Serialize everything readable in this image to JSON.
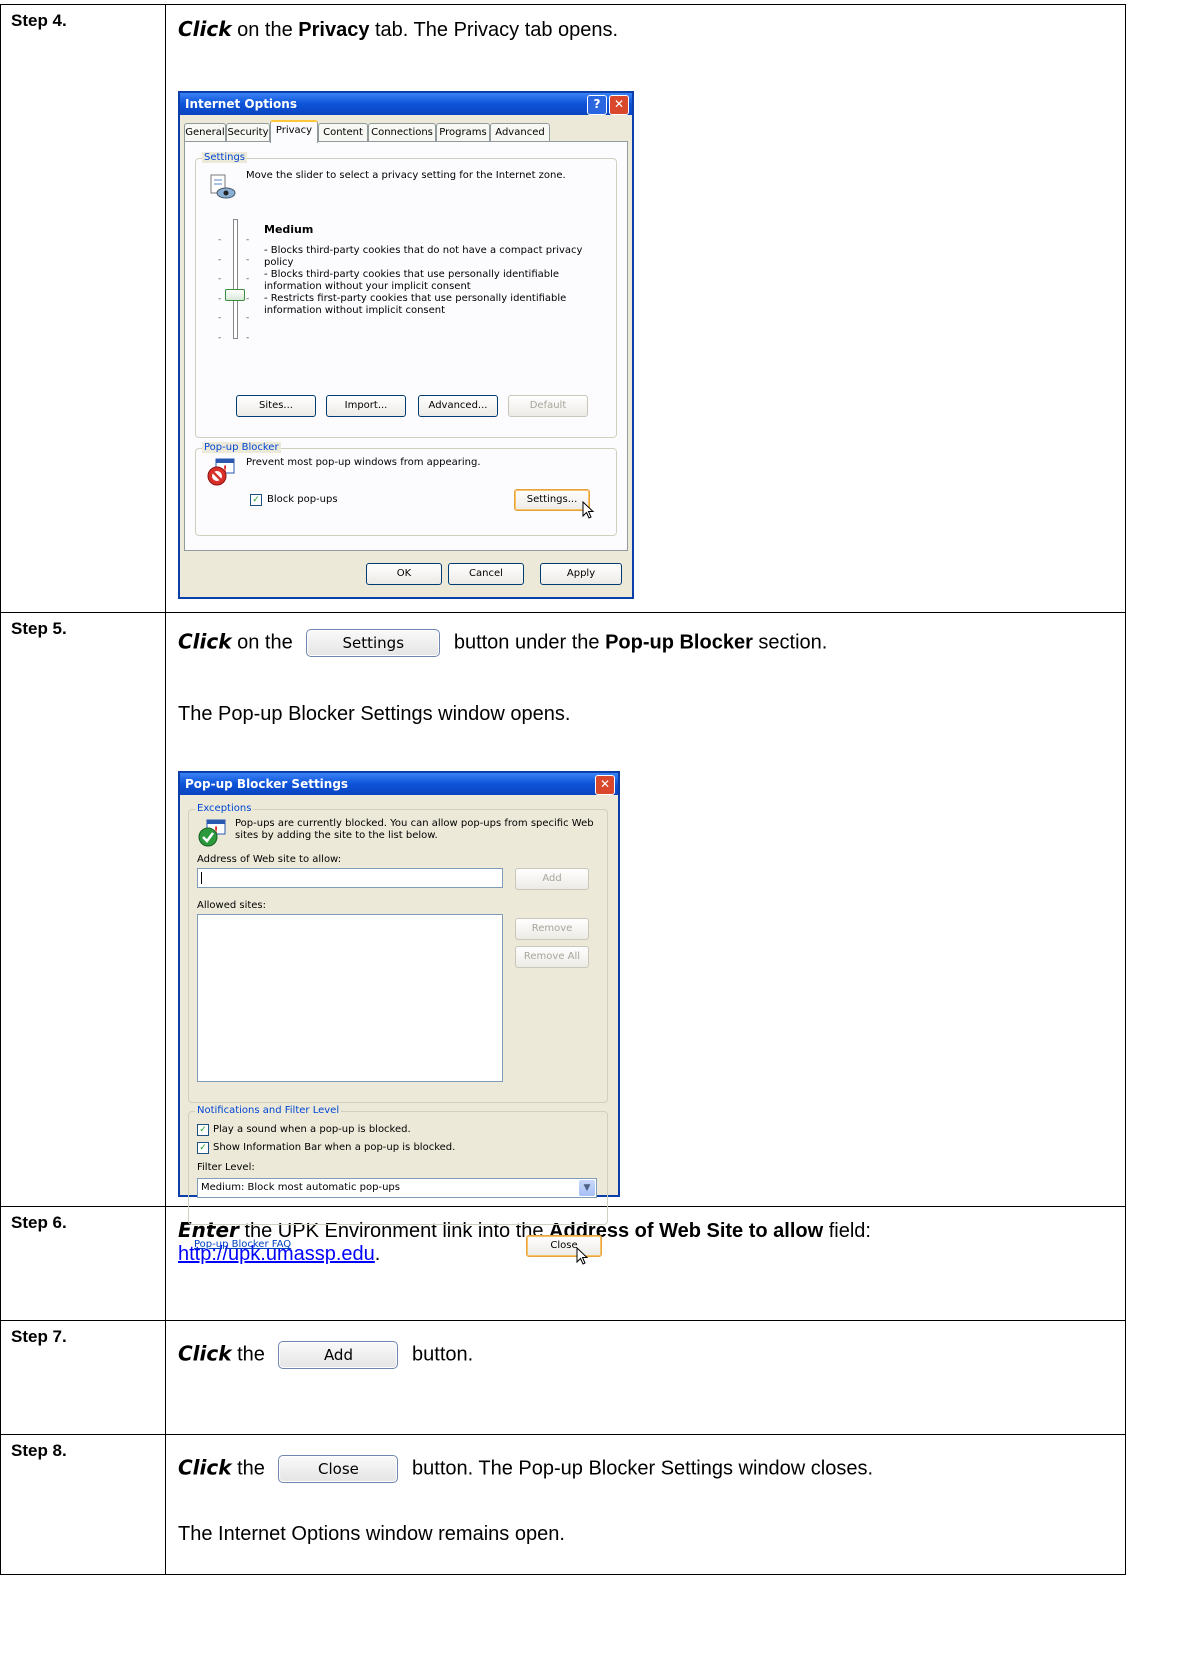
{
  "steps": {
    "s4": {
      "label": "Step 4.",
      "verb": "Click",
      "t1": " on the ",
      "bold1": "Privacy",
      "t2": " tab.  The Privacy tab opens."
    },
    "s5": {
      "label": "Step 5.",
      "verb": "Click",
      "t1": " on the ",
      "btn": "Settings",
      "t2": " button under the ",
      "bold1": "Pop-up Blocker",
      "t3": " section.",
      "p2": "The Pop-up Blocker Settings window opens."
    },
    "s6": {
      "label": "Step 6.",
      "verb": "Enter",
      "t1": " the UPK Environment link into the ",
      "bold1": "Address of Web Site to allow",
      "t2": " field: ",
      "link": "http://upk.umassp.edu",
      "t3": "."
    },
    "s7": {
      "label": "Step 7.",
      "verb": "Click",
      "t1": " the ",
      "btn": "Add",
      "t2": " button."
    },
    "s8": {
      "label": "Step 8.",
      "verb": "Click",
      "t1": " the ",
      "btn": "Close",
      "t2": " button.  The Pop-up Blocker Settings window closes.",
      "p2": "The Internet Options window remains open."
    }
  },
  "internet_options": {
    "title": "Internet Options",
    "help": "?",
    "close": "✕",
    "tabs": [
      "General",
      "Security",
      "Privacy",
      "Content",
      "Connections",
      "Programs",
      "Advanced"
    ],
    "settings_group": "Settings",
    "settings_desc": "Move the slider to select a privacy setting for the Internet zone.",
    "level": "Medium",
    "level_desc": [
      "- Blocks third-party cookies that do not have a compact privacy policy",
      "- Blocks third-party cookies that use personally identifiable information without your implicit consent",
      "- Restricts first-party cookies that use personally identifiable information without implicit consent"
    ],
    "buttons": {
      "sites": "Sites...",
      "import": "Import...",
      "advanced": "Advanced...",
      "default": "Default"
    },
    "popup_group": "Pop-up Blocker",
    "popup_desc": "Prevent most pop-up windows from appearing.",
    "block_popups": "Block pop-ups",
    "settings_btn": "Settings...",
    "ok": "OK",
    "cancel": "Cancel",
    "apply": "Apply"
  },
  "popup_settings": {
    "title": "Pop-up Blocker Settings",
    "close": "✕",
    "exceptions_group": "Exceptions",
    "exceptions_desc": "Pop-ups are currently blocked.  You can allow pop-ups from specific Web sites by adding the site to the list below.",
    "address_label": "Address of Web site to allow:",
    "address_value": "",
    "add": "Add",
    "allowed_label": "Allowed sites:",
    "remove": "Remove",
    "remove_all": "Remove All",
    "notif_group": "Notifications and Filter Level",
    "play_sound": "Play a sound when a pop-up is blocked.",
    "show_info": "Show Information Bar when a pop-up is blocked.",
    "filter_label": "Filter Level:",
    "filter_value": "Medium: Block most automatic pop-ups",
    "faq": "Pop-up Blocker FAQ",
    "close_btn": "Close"
  }
}
